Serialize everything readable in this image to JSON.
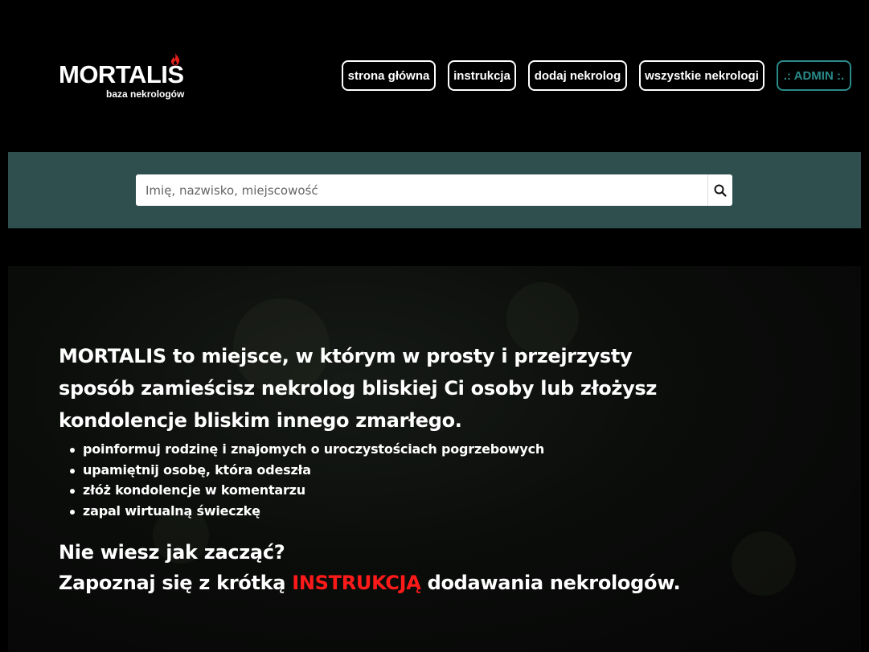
{
  "brand": {
    "name": "MORTALIS",
    "tagline": "baza nekrologów",
    "flame_icon": "flame-icon",
    "flame_color": "#e0201a"
  },
  "nav": {
    "items": [
      {
        "label": "strona główna"
      },
      {
        "label": "instrukcja"
      },
      {
        "label": "dodaj nekrolog"
      },
      {
        "label": "wszystkie nekrologi"
      },
      {
        "label": ".: ADMIN :."
      }
    ],
    "admin_color": "#2a8a8a"
  },
  "search": {
    "placeholder": "Imię, nazwisko, miejscowość",
    "value": "",
    "button_icon": "search-icon",
    "band_color": "#2f4f4f"
  },
  "hero": {
    "intro": "MORTALIS to miejsce, w którym w prosty i przejrzysty sposób zamieścisz nekrolog bliskiej Ci osoby lub złożysz kondolencje bliskim innego zmarłego.",
    "features": [
      "poinformuj rodzinę i znajomych o uroczystościach pogrzebowych",
      "upamiętnij osobę, która odeszła",
      "złóż kondolencje w komentarzu",
      "zapal wirtualną świeczkę"
    ],
    "cta_question": "Nie wiesz jak zacząć?",
    "cta_prefix": "Zapoznaj się z krótką ",
    "cta_link": "INSTRUKCJĄ",
    "cta_suffix": " dodawania nekrologów.",
    "cta_link_color": "#ff1a1a"
  }
}
